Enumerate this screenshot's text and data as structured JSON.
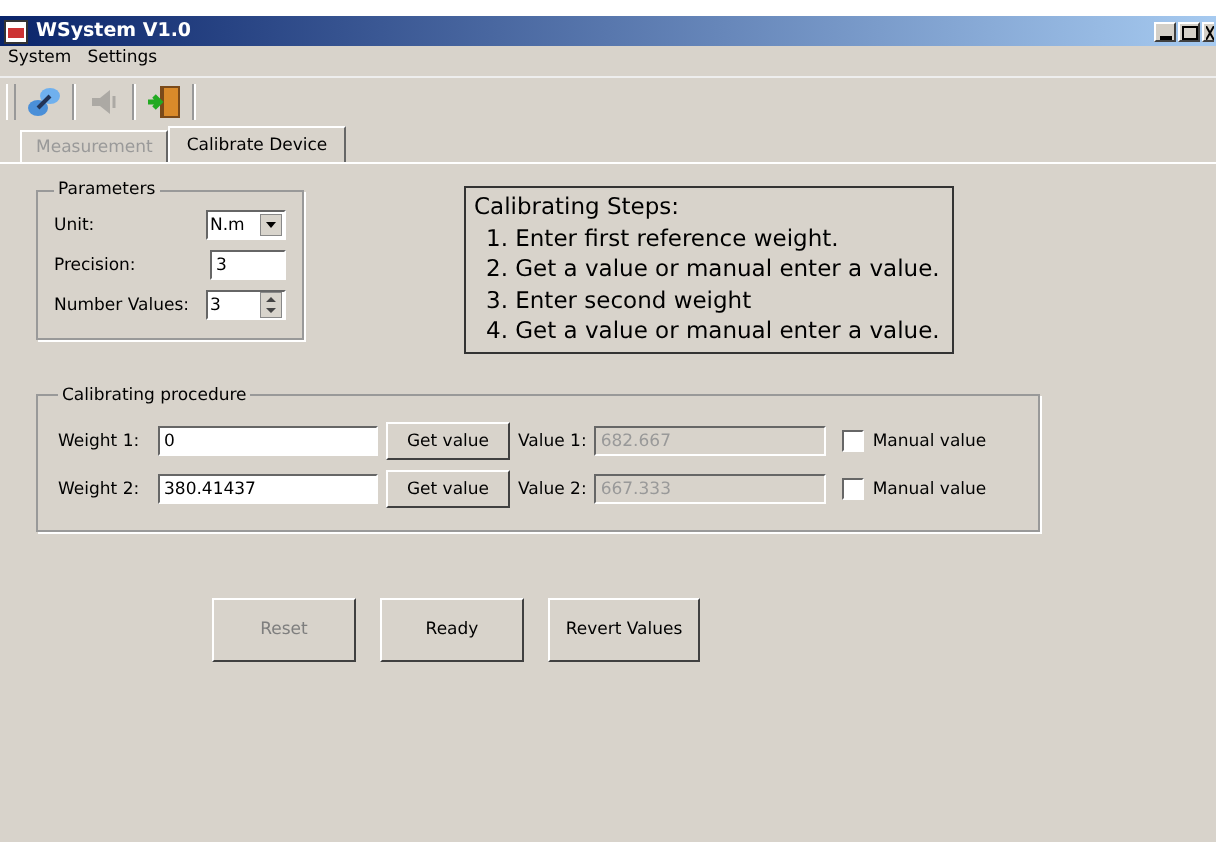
{
  "window": {
    "title": "WSystem V1.0"
  },
  "menu": [
    "System",
    "Settings"
  ],
  "toolbar": [
    {
      "disabled": false
    },
    {
      "disabled": true
    },
    {
      "disabled": false
    }
  ],
  "tabs": [
    {
      "label": "Measurement",
      "selected": false,
      "disabled": true
    },
    {
      "label": "Calibrate Device",
      "selected": true,
      "disabled": false
    }
  ],
  "parameters": {
    "title": "Parameters",
    "unit_label": "Unit:",
    "unit": "N.m",
    "precision_label": "Precision:",
    "precision": "3",
    "number_label": "Number Values:",
    "number": "3"
  },
  "steps": {
    "title": "Calibrating Steps:",
    "items": [
      "1. Enter first reference weight.",
      "2. Get a value or manual enter a value.",
      "3. Enter second weight",
      "4. Get a value or manual enter a value."
    ]
  },
  "procedure": {
    "title": "Calibrating procedure",
    "rows": [
      {
        "weight_label": "Weight 1:",
        "weight": "0",
        "button": "Get value",
        "value_label": "Value 1:",
        "value": "682.667",
        "manual_label": "Manual value",
        "checked": false
      },
      {
        "weight_label": "Weight 2:",
        "weight": "380.41437",
        "button": "Get value",
        "value_label": "Value 2:",
        "value": "667.333",
        "manual_label": "Manual value",
        "checked": false
      }
    ]
  },
  "buttons": [
    {
      "label": "Reset",
      "disabled": true
    },
    {
      "label": "Ready",
      "disabled": false
    },
    {
      "label": "Revert Values",
      "disabled": false
    }
  ]
}
